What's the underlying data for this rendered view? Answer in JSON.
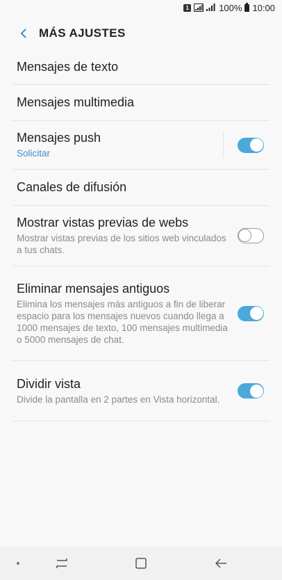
{
  "status_bar": {
    "sim_label": "1",
    "battery_percent": "100%",
    "time": "10:00"
  },
  "header": {
    "title": "MÁS AJUSTES"
  },
  "items": [
    {
      "title": "Mensajes de texto"
    },
    {
      "title": "Mensajes multimedia"
    },
    {
      "title": "Mensajes push",
      "subtitle": "Solicitar",
      "toggle": true
    },
    {
      "title": "Canales de difusión"
    },
    {
      "title": "Mostrar vistas previas de webs",
      "subtitle": "Mostrar vistas previas de los sitios web vinculados a tus chats.",
      "toggle": false
    },
    {
      "title": "Eliminar mensajes antiguos",
      "subtitle": "Elimina los mensajes más antiguos a fin de liberar espacio para los mensajes nuevos cuando llega a 1000 mensajes de texto, 100 mensajes multimedia o 5000 mensajes de chat.",
      "toggle": true
    },
    {
      "title": "Dividir vista",
      "subtitle": "Divide la pantalla en 2 partes en Vista horizontal.",
      "toggle": true
    }
  ],
  "colors": {
    "accent": "#4aa8db",
    "link": "#3a8fd1"
  },
  "icons": {
    "back": "arrow-left-icon",
    "nav_recent": "recent-apps-icon",
    "nav_home": "home-icon",
    "nav_back": "back-icon"
  }
}
